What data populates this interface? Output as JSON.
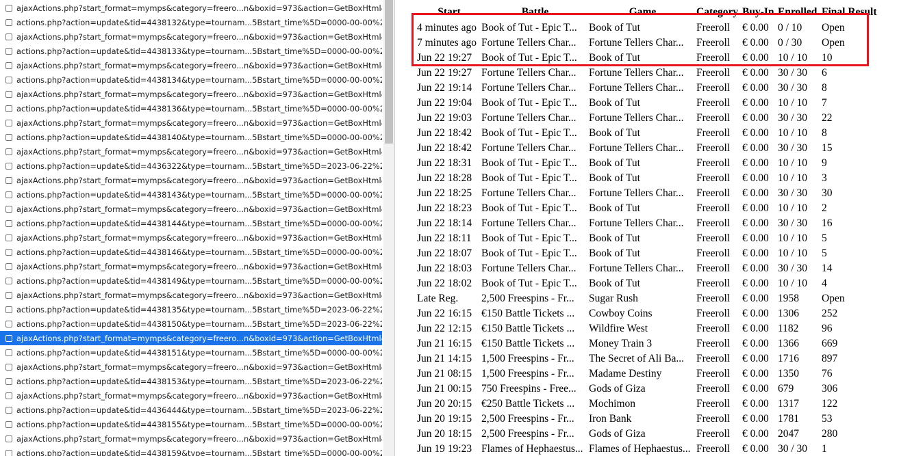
{
  "requests": [
    "ajaxActions.php?start_format=mymps&category=freero...n&boxid=973&action=GetBoxHtml&juri...",
    "actions.php?action=update&tid=4438132&type=tournam...5Bstart_time%5D=0000-00-00%2000%...",
    "ajaxActions.php?start_format=mymps&category=freero...n&boxid=973&action=GetBoxHtml&juri...",
    "actions.php?action=update&tid=4438133&type=tournam...5Bstart_time%5D=0000-00-00%2000%...",
    "ajaxActions.php?start_format=mymps&category=freero...n&boxid=973&action=GetBoxHtml&juri...",
    "actions.php?action=update&tid=4438134&type=tournam...5Bstart_time%5D=0000-00-00%2000%...",
    "ajaxActions.php?start_format=mymps&category=freero...n&boxid=973&action=GetBoxHtml&juri...",
    "actions.php?action=update&tid=4438136&type=tournam...5Bstart_time%5D=0000-00-00%2000%...",
    "ajaxActions.php?start_format=mymps&category=freero...n&boxid=973&action=GetBoxHtml&juri...",
    "actions.php?action=update&tid=4438140&type=tournam...5Bstart_time%5D=0000-00-00%2000%...",
    "ajaxActions.php?start_format=mymps&category=freero...n&boxid=973&action=GetBoxHtml&juri...",
    "actions.php?action=update&tid=4436322&type=tournam...5Bstart_time%5D=2023-06-22%2011%...",
    "ajaxActions.php?start_format=mymps&category=freero...n&boxid=973&action=GetBoxHtml&juri...",
    "actions.php?action=update&tid=4438143&type=tournam...5Bstart_time%5D=0000-00-00%2000%...",
    "ajaxActions.php?start_format=mymps&category=freero...n&boxid=973&action=GetBoxHtml&juri...",
    "actions.php?action=update&tid=4438144&type=tournam...5Bstart_time%5D=0000-00-00%2000%...",
    "ajaxActions.php?start_format=mymps&category=freero...n&boxid=973&action=GetBoxHtml&juri...",
    "actions.php?action=update&tid=4438146&type=tournam...5Bstart_time%5D=0000-00-00%2000%...",
    "ajaxActions.php?start_format=mymps&category=freero...n&boxid=973&action=GetBoxHtml&juri...",
    "actions.php?action=update&tid=4438149&type=tournam...5Bstart_time%5D=0000-00-00%2000%...",
    "ajaxActions.php?start_format=mymps&category=freero...n&boxid=973&action=GetBoxHtml&juri...",
    "actions.php?action=update&tid=4438135&type=tournam...5Bstart_time%5D=2023-06-22%2019%...",
    "actions.php?action=update&tid=4438150&type=tournam...5Bstart_time%5D=2023-06-22%2019%...",
    "ajaxActions.php?start_format=mymps&category=freero...n&boxid=973&action=GetBoxHtml&juri...",
    "actions.php?action=update&tid=4438151&type=tournam...5Bstart_time%5D=0000-00-00%2000%...",
    "ajaxActions.php?start_format=mymps&category=freero...n&boxid=973&action=GetBoxHtml&juri...",
    "actions.php?action=update&tid=4438153&type=tournam...5Bstart_time%5D=2023-06-22%2019%...",
    "ajaxActions.php?start_format=mymps&category=freero...n&boxid=973&action=GetBoxHtml&juri...",
    "actions.php?action=update&tid=4436444&type=tournam...5Bstart_time%5D=2023-06-22%2018%...",
    "actions.php?action=update&tid=4438155&type=tournam...5Bstart_time%5D=0000-00-00%2000%...",
    "ajaxActions.php?start_format=mymps&category=freero...n&boxid=973&action=GetBoxHtml&juri...",
    "actions.php?action=update&tid=4438159&type=tournam...5Bstart_time%5D=0000-00-00%2000%..."
  ],
  "selected_index": 23,
  "table": {
    "headers": [
      "Start",
      "Battle",
      "Game",
      "Category",
      "Buy-In",
      "Enrolled",
      "Final Result"
    ],
    "rows": [
      [
        "4 minutes ago",
        "Book of Tut - Epic T...",
        "Book of Tut",
        "Freeroll",
        "€ 0.00",
        "0 / 10",
        "Open"
      ],
      [
        "7 minutes ago",
        "Fortune Tellers Char...",
        "Fortune Tellers Char...",
        "Freeroll",
        "€ 0.00",
        "0 / 30",
        "Open"
      ],
      [
        "Jun 22 19:27",
        "Book of Tut - Epic T...",
        "Book of Tut",
        "Freeroll",
        "€ 0.00",
        "10 / 10",
        "10"
      ],
      [
        "Jun 22 19:27",
        "Fortune Tellers Char...",
        "Fortune Tellers Char...",
        "Freeroll",
        "€ 0.00",
        "30 / 30",
        "6"
      ],
      [
        "Jun 22 19:14",
        "Fortune Tellers Char...",
        "Fortune Tellers Char...",
        "Freeroll",
        "€ 0.00",
        "30 / 30",
        "8"
      ],
      [
        "Jun 22 19:04",
        "Book of Tut - Epic T...",
        "Book of Tut",
        "Freeroll",
        "€ 0.00",
        "10 / 10",
        "7"
      ],
      [
        "Jun 22 19:03",
        "Fortune Tellers Char...",
        "Fortune Tellers Char...",
        "Freeroll",
        "€ 0.00",
        "30 / 30",
        "22"
      ],
      [
        "Jun 22 18:42",
        "Book of Tut - Epic T...",
        "Book of Tut",
        "Freeroll",
        "€ 0.00",
        "10 / 10",
        "8"
      ],
      [
        "Jun 22 18:42",
        "Fortune Tellers Char...",
        "Fortune Tellers Char...",
        "Freeroll",
        "€ 0.00",
        "30 / 30",
        "15"
      ],
      [
        "Jun 22 18:31",
        "Book of Tut - Epic T...",
        "Book of Tut",
        "Freeroll",
        "€ 0.00",
        "10 / 10",
        "9"
      ],
      [
        "Jun 22 18:28",
        "Book of Tut - Epic T...",
        "Book of Tut",
        "Freeroll",
        "€ 0.00",
        "10 / 10",
        "3"
      ],
      [
        "Jun 22 18:25",
        "Fortune Tellers Char...",
        "Fortune Tellers Char...",
        "Freeroll",
        "€ 0.00",
        "30 / 30",
        "30"
      ],
      [
        "Jun 22 18:23",
        "Book of Tut - Epic T...",
        "Book of Tut",
        "Freeroll",
        "€ 0.00",
        "10 / 10",
        "2"
      ],
      [
        "Jun 22 18:14",
        "Fortune Tellers Char...",
        "Fortune Tellers Char...",
        "Freeroll",
        "€ 0.00",
        "30 / 30",
        "16"
      ],
      [
        "Jun 22 18:11",
        "Book of Tut - Epic T...",
        "Book of Tut",
        "Freeroll",
        "€ 0.00",
        "10 / 10",
        "5"
      ],
      [
        "Jun 22 18:07",
        "Book of Tut - Epic T...",
        "Book of Tut",
        "Freeroll",
        "€ 0.00",
        "10 / 10",
        "5"
      ],
      [
        "Jun 22 18:03",
        "Fortune Tellers Char...",
        "Fortune Tellers Char...",
        "Freeroll",
        "€ 0.00",
        "30 / 30",
        "14"
      ],
      [
        "Jun 22 18:02",
        "Book of Tut - Epic T...",
        "Book of Tut",
        "Freeroll",
        "€ 0.00",
        "10 / 10",
        "4"
      ],
      [
        "Late Reg.",
        "2,500 Freespins - Fr...",
        "Sugar Rush",
        "Freeroll",
        "€ 0.00",
        "1958",
        "Open"
      ],
      [
        "Jun 22 16:15",
        "€150 Battle Tickets ...",
        "Cowboy Coins",
        "Freeroll",
        "€ 0.00",
        "1306",
        "252"
      ],
      [
        "Jun 22 12:15",
        "€150 Battle Tickets ...",
        "Wildfire West",
        "Freeroll",
        "€ 0.00",
        "1182",
        "96"
      ],
      [
        "Jun 21 16:15",
        "€150 Battle Tickets ...",
        "Money Train 3",
        "Freeroll",
        "€ 0.00",
        "1366",
        "669"
      ],
      [
        "Jun 21 14:15",
        "1,500 Freespins - Fr...",
        "The Secret of Ali Ba...",
        "Freeroll",
        "€ 0.00",
        "1716",
        "897"
      ],
      [
        "Jun 21 08:15",
        "1,500 Freespins - Fr...",
        "Madame Destiny",
        "Freeroll",
        "€ 0.00",
        "1350",
        "76"
      ],
      [
        "Jun 21 00:15",
        "750 Freespins - Free...",
        "Gods of Giza",
        "Freeroll",
        "€ 0.00",
        "679",
        "306"
      ],
      [
        "Jun 20 20:15",
        "€250 Battle Tickets ...",
        "Mochimon",
        "Freeroll",
        "€ 0.00",
        "1317",
        "122"
      ],
      [
        "Jun 20 19:15",
        "2,500 Freespins - Fr...",
        "Iron Bank",
        "Freeroll",
        "€ 0.00",
        "1781",
        "53"
      ],
      [
        "Jun 20 18:15",
        "2,500 Freespins - Fr...",
        "Gods of Giza",
        "Freeroll",
        "€ 0.00",
        "2047",
        "280"
      ],
      [
        "Jun 19 19:23",
        "Flames of Hephaestus...",
        "Flames of Hephaestus...",
        "Freeroll",
        "€ 0.00",
        "30 / 30",
        "1"
      ]
    ]
  },
  "colors": {
    "selection": "#1a73e8",
    "highlight_border": "#e8141f"
  }
}
